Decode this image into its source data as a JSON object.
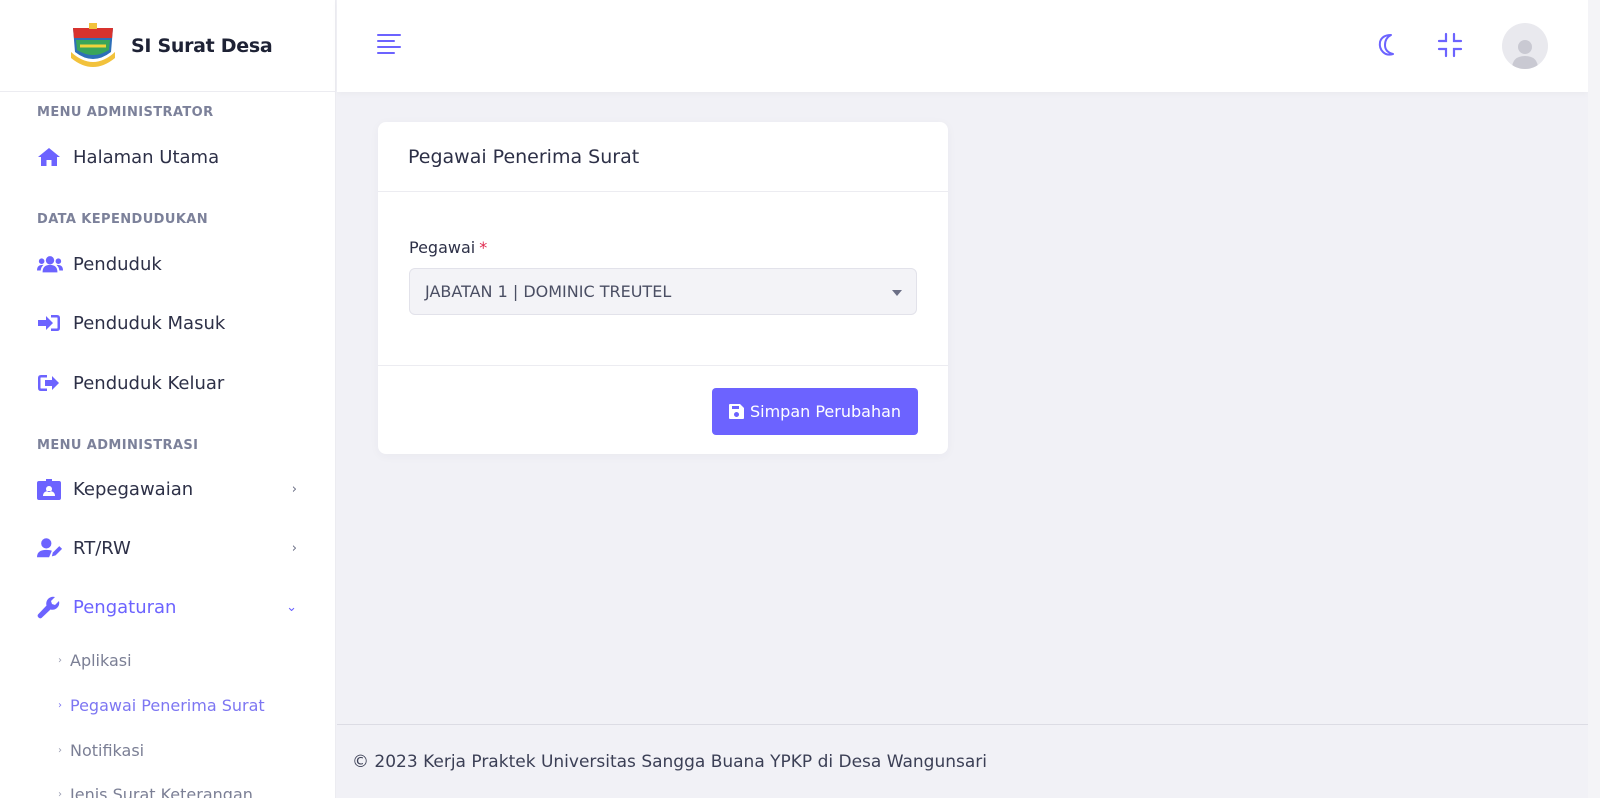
{
  "brand": {
    "name": "SI Surat Desa",
    "logo_icon": "village-emblem-logo"
  },
  "sidebar": {
    "sections": [
      {
        "heading": "MENU ADMINISTRATOR"
      },
      {
        "heading": "DATA KEPENDUDUKAN"
      },
      {
        "heading": "MENU ADMINISTRASI"
      }
    ],
    "items": [
      {
        "label": "Halaman Utama",
        "icon": "home-icon"
      },
      {
        "label": "Penduduk",
        "icon": "users-icon"
      },
      {
        "label": "Penduduk Masuk",
        "icon": "sign-in-icon"
      },
      {
        "label": "Penduduk Keluar",
        "icon": "sign-out-icon"
      },
      {
        "label": "Kepegawaian",
        "icon": "id-badge-icon",
        "chevron": "›"
      },
      {
        "label": "RT/RW",
        "icon": "user-edit-icon",
        "chevron": "›"
      },
      {
        "label": "Pengaturan",
        "icon": "wrench-icon",
        "chevron": "⌄"
      }
    ],
    "subitems": [
      {
        "label": "Aplikasi"
      },
      {
        "label": "Pegawai Penerima Surat"
      },
      {
        "label": "Notifikasi"
      },
      {
        "label": "Jenis Surat Keterangan"
      }
    ],
    "sub_bullet": "›"
  },
  "topbar": {
    "menu_icon": "hamburger-icon",
    "theme_icon": "moon-icon",
    "fullscreen_icon": "compress-icon",
    "avatar_icon": "user-avatar-icon"
  },
  "card": {
    "title": "Pegawai Penerima Surat",
    "field_label": "Pegawai",
    "required_mark": "*",
    "select_value": "JABATAN 1 | DOMINIC TREUTEL",
    "save_label": "Simpan Perubahan"
  },
  "footer": {
    "text": "© 2023 Kerja Praktek Universitas Sangga Buana YPKP di Desa Wangunsari"
  },
  "colors": {
    "accent": "#6c63ff",
    "required": "#e0294e",
    "background": "#f1f1f6"
  }
}
